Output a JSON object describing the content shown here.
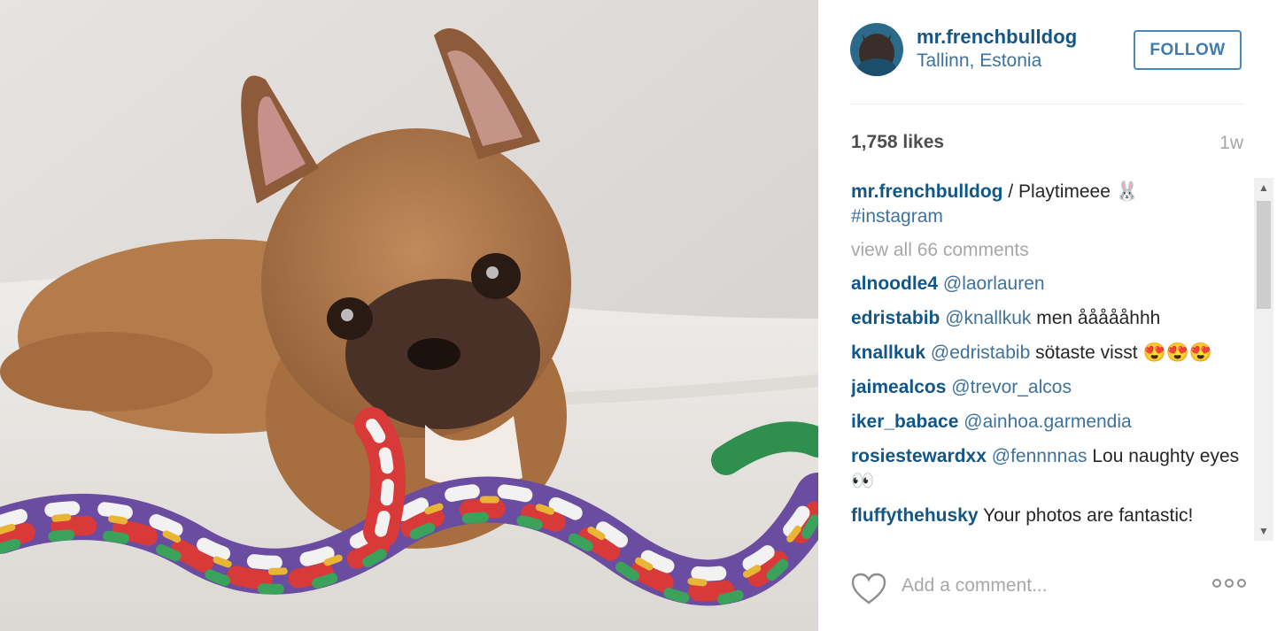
{
  "post": {
    "image_alt": "French bulldog puppy chewing a colorful rope toy",
    "username": "mr.frenchbulldog",
    "location": "Tallinn, Estonia",
    "follow_label": "FOLLOW",
    "likes": "1,758 likes",
    "time_ago": "1w"
  },
  "caption": {
    "username": "mr.frenchbulldog",
    "text": " / Playtimeee 🐰",
    "hashtag": "#instagram"
  },
  "view_all": "view all 66 comments",
  "comments": [
    {
      "user": "alnoodle4",
      "mention": "@laorlauren",
      "text": ""
    },
    {
      "user": "edristabib",
      "mention": "@knallkuk",
      "text": " men åååååhhh"
    },
    {
      "user": "knallkuk",
      "mention": "@edristabib",
      "text": " sötaste visst 😍😍😍"
    },
    {
      "user": "jaimealcos",
      "mention": "@trevor_alcos",
      "text": ""
    },
    {
      "user": "iker_babace",
      "mention": "@ainhoa.garmendia",
      "text": ""
    },
    {
      "user": "rosiestewardxx",
      "mention": "@fennnnas",
      "text": " Lou naughty eyes 👀"
    },
    {
      "user": "fluffythehusky",
      "mention": "",
      "text": " Your photos are fantastic!"
    }
  ],
  "add_comment_placeholder": "Add a comment...",
  "icons": {
    "heart": "heart-outline-icon",
    "more": "more-options-icon",
    "scroll_up": "scroll-up-arrow-icon",
    "scroll_down": "scroll-down-arrow-icon"
  },
  "colors": {
    "username": "#125688",
    "link": "#3f729b",
    "muted": "#a5a7aa",
    "follow_border": "#4b88b7"
  }
}
